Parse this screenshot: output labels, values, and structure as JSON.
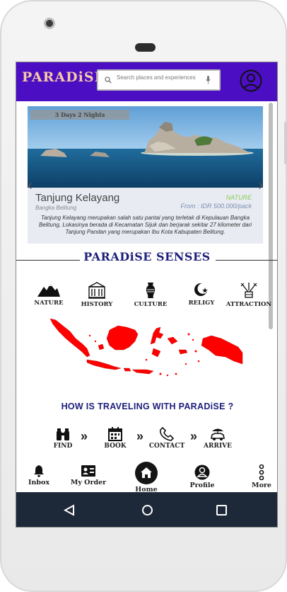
{
  "header": {
    "brand": "PARADiSE",
    "search_placeholder": "Search places and experiences"
  },
  "banner": {
    "duration_tag": "3 Days 2 Nights",
    "place": "Tanjung Kelayang",
    "region": "Bangka Belitung",
    "type": "NATURE",
    "price": "From : IDR 500.000/pack",
    "description": "Tanjung Kelayang merupakan salah satu pantai yang terletak di Kepulauan Bangka Belitung, Lokasinya berada di Kecamatan Sijuk dan berjarak sekitar 27 kilometer dari Tanjung Pandan yang merupakan Ibu Kota Kabupaten Belitung."
  },
  "senses": {
    "title": "PARADiSE SENSES",
    "categories": [
      {
        "label": "NATURE",
        "icon": "mountain-icon"
      },
      {
        "label": "HISTORY",
        "icon": "building-icon"
      },
      {
        "label": "CULTURE",
        "icon": "vase-icon"
      },
      {
        "label": "RELIGY",
        "icon": "crescent-star-icon"
      },
      {
        "label": "ATTRACTION",
        "icon": "fireworks-icon"
      }
    ]
  },
  "how": {
    "title": "HOW IS TRAVELING WITH PARADiSE ?",
    "steps": [
      {
        "label": "FIND",
        "icon": "binoculars-icon"
      },
      {
        "label": "BOOK",
        "icon": "calendar-icon"
      },
      {
        "label": "CONTACT",
        "icon": "phone-icon"
      },
      {
        "label": "ARRIVE",
        "icon": "car-icon"
      }
    ]
  },
  "bottom_nav": [
    {
      "label": "Inbox",
      "icon": "bell-icon"
    },
    {
      "label": "My Order",
      "icon": "id-card-icon"
    },
    {
      "label": "Home",
      "icon": "home-icon"
    },
    {
      "label": "Profile",
      "icon": "profile-icon"
    },
    {
      "label": "More",
      "icon": "more-vertical-icon"
    }
  ],
  "colors": {
    "header": "#4b0ec2",
    "brand": "#f7c9a6",
    "heading": "#1d1e7a",
    "map": "#ff0000",
    "system_nav": "#1d2939"
  }
}
